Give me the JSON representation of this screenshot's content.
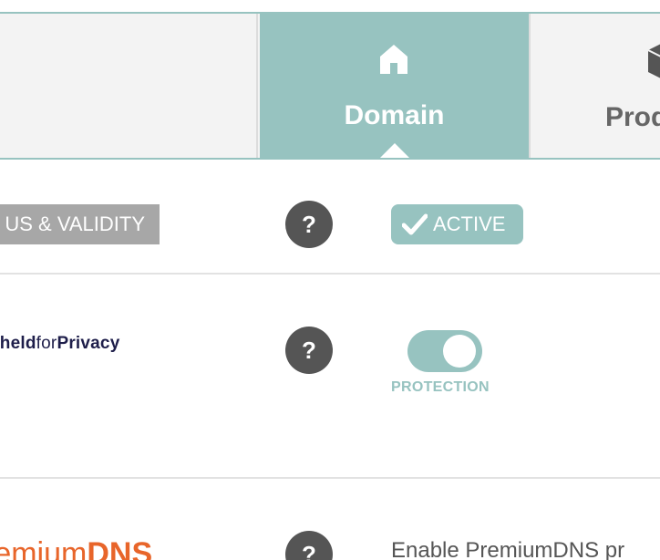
{
  "tabs": {
    "domain": {
      "label": "Domain",
      "icon": "home-icon"
    },
    "products": {
      "label": "Prod",
      "icon": "box-icon"
    }
  },
  "rows": {
    "status": {
      "label": "US & VALIDITY",
      "help": "?",
      "badge": {
        "text": "ACTIVE",
        "icon": "check-icon"
      }
    },
    "privacy": {
      "logo_part1": "hheld",
      "logo_part2": "for",
      "logo_part3": "Privacy",
      "help": "?",
      "toggle_on": true,
      "toggle_label": "PROTECTION"
    },
    "premium_dns": {
      "logo_part1": "remium",
      "logo_part2": "DNS",
      "help": "?",
      "description": "Enable PremiumDNS pr"
    }
  },
  "colors": {
    "accent": "#97c3c0",
    "help_button": "#555555",
    "status_label_bg": "#a7a7a7",
    "privacy_logo": "#1e1e4a",
    "premium_logo": "#e8652a"
  }
}
